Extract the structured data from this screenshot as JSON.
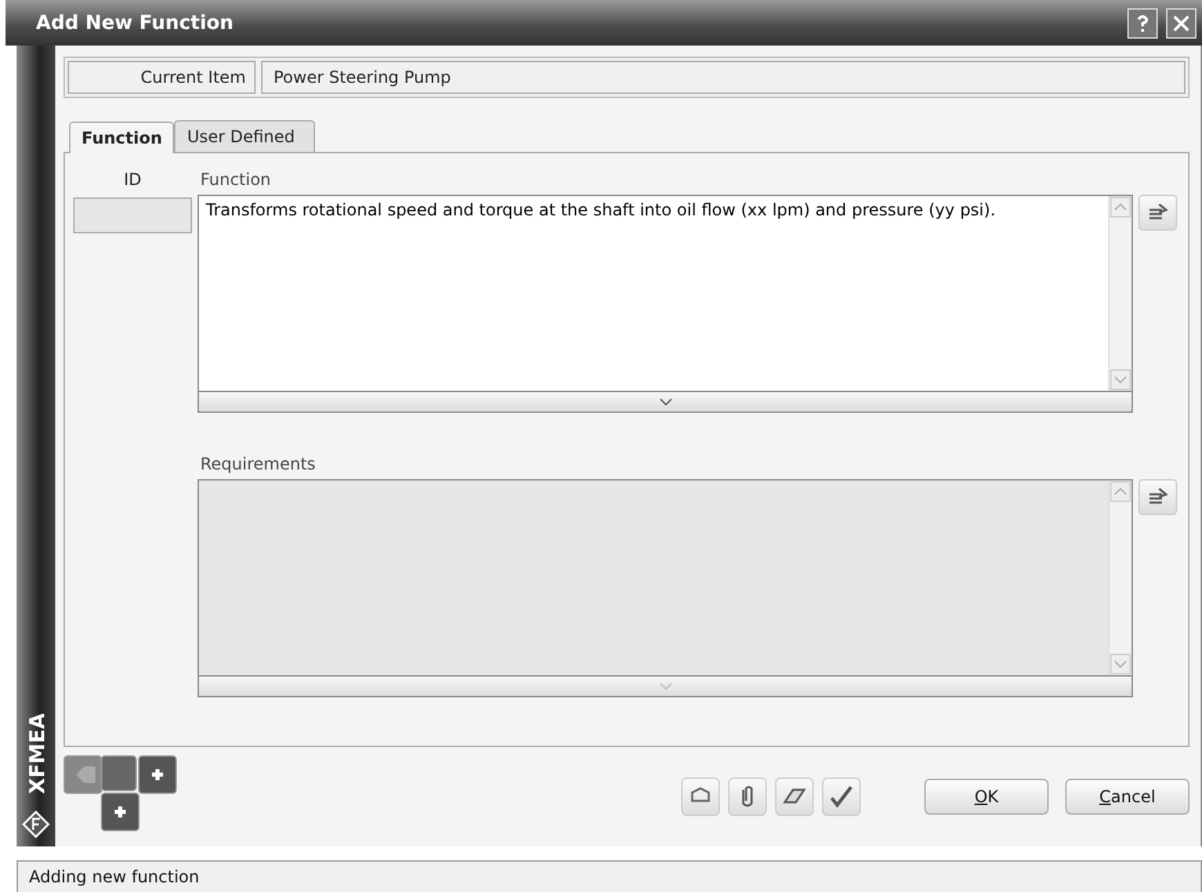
{
  "window": {
    "title": "Add New Function"
  },
  "current_item": {
    "label": "Current Item",
    "value": "Power Steering Pump"
  },
  "tabs": [
    {
      "label": "Function",
      "selected": true
    },
    {
      "label": "User Defined",
      "selected": false
    }
  ],
  "id_field": {
    "label": "ID"
  },
  "fields": [
    {
      "label": "Function",
      "value": "Transforms rotational speed and torque at the shaft into oil flow (xx lpm) and pressure (yy psi).",
      "disabled": false
    },
    {
      "label": "Requirements",
      "disabled": true
    }
  ],
  "side_logo": "XFMEA",
  "buttons": [
    "OK",
    "Cancel"
  ],
  "status_bar": "Adding new function"
}
